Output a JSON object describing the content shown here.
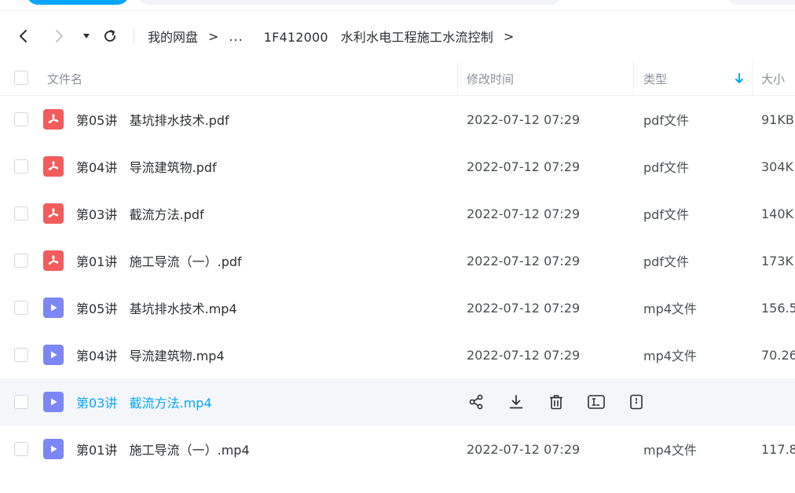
{
  "breadcrumb": {
    "root": "我的网盘",
    "ellipsis": "...",
    "current": "1F412000   水利水电工程施工水流控制",
    "separator": ">"
  },
  "columns": {
    "name": "文件名",
    "modified": "修改时间",
    "type": "类型",
    "size": "大小"
  },
  "colors": {
    "accent": "#06a7ff",
    "pdf_icon": "#f25c5c",
    "video_icon": "#7c86f4",
    "hover_row": "#f4f6fa"
  },
  "files": [
    {
      "name": "第05讲   基坑排水技术.pdf",
      "modified": "2022-07-12 07:29",
      "type": "pdf文件",
      "size": "91KB",
      "icon": "pdf-icon"
    },
    {
      "name": "第04讲   导流建筑物.pdf",
      "modified": "2022-07-12 07:29",
      "type": "pdf文件",
      "size": "304K",
      "icon": "pdf-icon"
    },
    {
      "name": "第03讲   截流方法.pdf",
      "modified": "2022-07-12 07:29",
      "type": "pdf文件",
      "size": "140K",
      "icon": "pdf-icon"
    },
    {
      "name": "第01讲   施工导流（一）.pdf",
      "modified": "2022-07-12 07:29",
      "type": "pdf文件",
      "size": "173K",
      "icon": "pdf-icon"
    },
    {
      "name": "第05讲   基坑排水技术.mp4",
      "modified": "2022-07-12 07:29",
      "type": "mp4文件",
      "size": "156.5",
      "icon": "video-icon"
    },
    {
      "name": "第04讲   导流建筑物.mp4",
      "modified": "2022-07-12 07:29",
      "type": "mp4文件",
      "size": "70.26",
      "icon": "video-icon"
    },
    {
      "name": "第03讲   截流方法.mp4",
      "hovered": true,
      "icon": "video-icon"
    },
    {
      "name": "第01讲   施工导流（一）.mp4",
      "modified": "2022-07-12 07:29",
      "type": "mp4文件",
      "size": "117.8",
      "icon": "video-icon"
    }
  ],
  "row_actions": [
    "share-icon",
    "download-icon",
    "delete-icon",
    "rename-icon",
    "more-icon"
  ]
}
